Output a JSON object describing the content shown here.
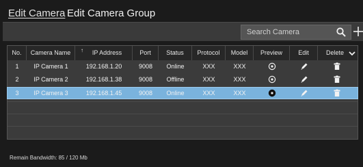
{
  "tabs": {
    "edit_camera": "Edit Camera",
    "edit_camera_group": "Edit Camera Group"
  },
  "search": {
    "placeholder": "Search Camera",
    "icon": "search-icon"
  },
  "toolbar": {
    "add_icon": "plus-icon"
  },
  "table": {
    "columns": [
      "No.",
      "Camera Name",
      "IP Address",
      "Port",
      "Status",
      "Protocol",
      "Model",
      "Preview",
      "Edit",
      "Delete"
    ],
    "sort_indicator": "↑",
    "rows": [
      {
        "no": "1",
        "name": "IP Camera 1",
        "ip": "192.168.1.20",
        "port": "9008",
        "status": "Online",
        "protocol": "XXX",
        "model": "XXX",
        "selected": false
      },
      {
        "no": "2",
        "name": "IP Camera 2",
        "ip": "192.168.1.38",
        "port": "9008",
        "status": "Offline",
        "protocol": "XXX",
        "model": "XXX",
        "selected": false
      },
      {
        "no": "3",
        "name": "IP Camera 3",
        "ip": "192.168.1.45",
        "port": "9008",
        "status": "Online",
        "protocol": "XXX",
        "model": "XXX",
        "selected": true
      }
    ]
  },
  "footer": {
    "bandwidth": "Remain Bandwidth: 85 / 120 Mb"
  },
  "colors": {
    "background": "#1b1b1b",
    "toolbar": "#3a3a3a",
    "header": "#272727",
    "selected_row": "#7ab3dd"
  }
}
